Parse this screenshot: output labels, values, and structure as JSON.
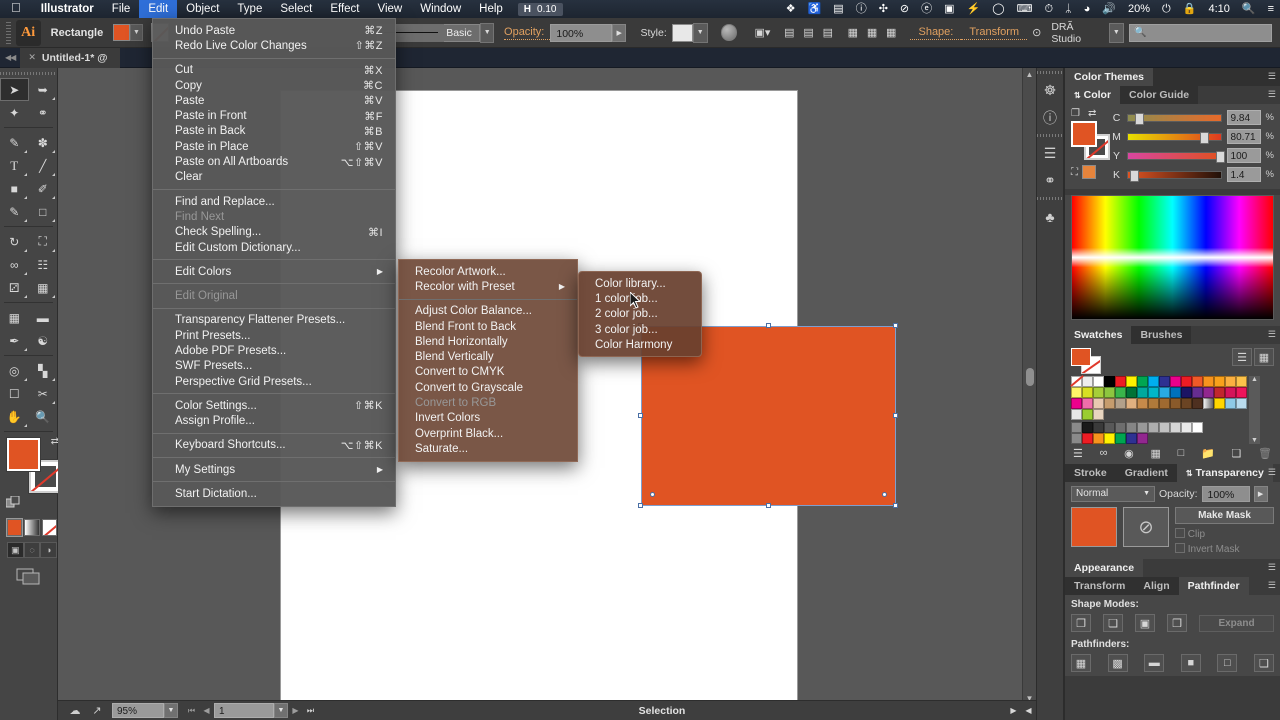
{
  "macbar": {
    "apple_icon": "apple-icon",
    "items": [
      {
        "label": "Illustrator",
        "bold": true,
        "active": false
      },
      {
        "label": "File",
        "bold": false,
        "active": false
      },
      {
        "label": "Edit",
        "bold": false,
        "active": true
      },
      {
        "label": "Object",
        "bold": false,
        "active": false
      },
      {
        "label": "Type",
        "bold": false,
        "active": false
      },
      {
        "label": "Select",
        "bold": false,
        "active": false
      },
      {
        "label": "Effect",
        "bold": false,
        "active": false
      },
      {
        "label": "View",
        "bold": false,
        "active": false
      },
      {
        "label": "Window",
        "bold": false,
        "active": false
      },
      {
        "label": "Help",
        "bold": false,
        "active": false
      }
    ],
    "badge": {
      "icon": "H",
      "value": "0.10"
    },
    "tray": [
      {
        "name": "dropbox-icon",
        "glyph": "❖"
      },
      {
        "name": "bell-icon",
        "glyph": "🔔"
      },
      {
        "name": "calendar-icon",
        "glyph": "📅"
      },
      {
        "name": "info-circle-icon",
        "glyph": "ⓘ"
      },
      {
        "name": "crosshair-icon",
        "glyph": "✣"
      },
      {
        "name": "do-not-disturb-icon",
        "glyph": "⊘"
      },
      {
        "name": "evernote-icon",
        "glyph": "ⓔ"
      },
      {
        "name": "airplay-icon",
        "glyph": "⬜"
      },
      {
        "name": "flash-icon",
        "glyph": "⚡"
      },
      {
        "name": "messages-icon",
        "glyph": "💬"
      },
      {
        "name": "keyboard-icon",
        "glyph": "⌸"
      },
      {
        "name": "timemachine-icon",
        "glyph": "⏲"
      },
      {
        "name": "bluetooth-icon",
        "glyph": "ᛦ"
      },
      {
        "name": "wifi-icon",
        "glyph": "📶"
      },
      {
        "name": "volume-icon",
        "glyph": "🔊"
      }
    ],
    "battery": "20%",
    "battery_icon": "battery-charging-icon",
    "lock_icon": "lock-icon",
    "clock": "4:10",
    "search_icon": "search-icon",
    "list_icon": "notification-center-icon"
  },
  "controlbar": {
    "app_logo": "Ai",
    "shape_label": "Rectangle",
    "fill_color": "#e05423",
    "stroke_label": "stroke-swatch",
    "brush_label": "Basic",
    "opacity_label": "Opacity:",
    "opacity_value": "100%",
    "style_label": "Style:",
    "shape_link": "Shape:",
    "transform_link": "Transform",
    "align_icons": [
      "align-left-icon",
      "align-center-icon",
      "align-right-icon",
      "distribute-left-icon",
      "distribute-center-icon",
      "distribute-right-icon"
    ],
    "isolate_icon": "isolate-selected-icon",
    "workspace": "DRÃ Studio",
    "search_placeholder": ""
  },
  "tabbar": {
    "doc_title": "Untitled-1* @",
    "close_icon": "close-icon"
  },
  "toolbar": {
    "tools": [
      [
        "selection-tool",
        "direct-selection-tool"
      ],
      [
        "magic-wand-tool",
        "lasso-tool"
      ],
      [
        "pen-tool",
        "curvature-tool"
      ],
      [
        "type-tool",
        "line-segment-tool"
      ],
      [
        "rectangle-tool",
        "paintbrush-tool"
      ],
      [
        "pencil-tool",
        "eraser-tool"
      ],
      [
        "rotate-tool",
        "scale-tool"
      ],
      [
        "width-tool",
        "free-transform-tool"
      ],
      [
        "shape-builder-tool",
        "perspective-grid-tool"
      ],
      [
        "mesh-tool",
        "gradient-tool"
      ],
      [
        "eyedropper-tool",
        "blend-tool"
      ],
      [
        "symbol-sprayer-tool",
        "column-graph-tool"
      ],
      [
        "artboard-tool",
        "slice-tool"
      ],
      [
        "hand-tool",
        "zoom-tool"
      ]
    ],
    "fill_color": "#e05423",
    "stroke_color": "#ffffff",
    "fill_stroke_name": "fill-stroke-indicator",
    "color_mode_icons": [
      "color-mode-icon",
      "gradient-mode-icon",
      "none-mode-icon"
    ],
    "draw_mode_icons": [
      "draw-normal-icon",
      "draw-behind-icon",
      "draw-inside-icon"
    ],
    "screen_mode_icon": "change-screen-mode-icon"
  },
  "canvas": {
    "artboard_name": "artboard",
    "rect_color": "#e05423",
    "selection_name": "selected-rectangle"
  },
  "statusbar": {
    "icons": [
      "cloud-sync-icon",
      "share-icon"
    ],
    "zoom": "95%",
    "page": "1",
    "status_text": "Selection"
  },
  "dock": {
    "icons": [
      "ship-wheel-icon",
      "info-icon",
      "layers-icon",
      "creative-cloud-icon",
      "symbols-icon"
    ]
  },
  "panels": {
    "color_themes": {
      "title": "Color Themes",
      "menu_icon": "panel-menu-icon"
    },
    "color": {
      "tabs": [
        "Color",
        "Color Guide"
      ],
      "active_tab": "Color",
      "fill_color": "#e05423",
      "channels": [
        {
          "label": "C",
          "value": "9.84",
          "unit": "%",
          "pos": 9.84,
          "from": "#8d8d50",
          "to": "#e86a2a"
        },
        {
          "label": "M",
          "value": "80.71",
          "unit": "%",
          "pos": 80.71,
          "from": "#e8e000",
          "to": "#e03a20"
        },
        {
          "label": "Y",
          "value": "100",
          "unit": "%",
          "pos": 100,
          "from": "#d846a0",
          "to": "#e0511f"
        },
        {
          "label": "K",
          "value": "1.4",
          "unit": "%",
          "pos": 1.4,
          "from": "#e05423",
          "to": "#201008"
        }
      ]
    },
    "swatches": {
      "tabs": [
        "Swatches",
        "Brushes"
      ],
      "active_tab": "Swatches",
      "list_icon": "list-view-icon",
      "grid_icon": "grid-view-icon",
      "rows": [
        [
          "none",
          "registration",
          "#ffffff",
          "#000000",
          "#ed1c24",
          "#fff200",
          "#00a651",
          "#00aeef",
          "#2e3192",
          "#ec008c",
          "#ed1c24",
          "#f05a28",
          "#f7941e",
          "#f9a11b",
          "#fbb040"
        ],
        [
          "#fff568",
          "#d7df23",
          "#8dc63f",
          "#39b54a",
          "#007236",
          "#00a99d",
          "#00b6c9",
          "#29abe2",
          "#0071bc",
          "#1b1464",
          "#662d91",
          "#92278f",
          "#c1272d",
          "#d4145a",
          "#ed145b"
        ],
        [
          "#ec008c",
          "#f06eaa",
          "#c69c6d",
          "#b3a08a",
          "#b88a6a",
          "#e0b080",
          "#c68a4a",
          "#a06a30",
          "#8a5a2a",
          "#6b4423",
          "#4e3020",
          "#3a2314",
          "#f5f5f5",
          "#ffd700",
          "#8ecae6"
        ],
        [
          "pattern-swatch-1",
          "pattern-swatch-2",
          "pattern-swatch-3"
        ],
        [
          "folder",
          "#1a1a1a",
          "#3a3a3a",
          "#595959",
          "#6e6e6e",
          "#858585",
          "#999999",
          "#adadad",
          "#c2c2c2",
          "#d6d6d6",
          "#eaeaea",
          "#ffffff"
        ],
        [
          "folder",
          "#ed1c24",
          "#f7941e",
          "#fff200",
          "#00a651",
          "#2e3192",
          "#92278f"
        ]
      ],
      "footer_icons": [
        "swatch-libraries-icon",
        "color-links-icon",
        "show-kinds-icon",
        "swatch-options-icon",
        "new-color-group-icon",
        "new-swatch-icon",
        "delete-swatch-icon"
      ]
    },
    "transparency": {
      "tabs": [
        "Stroke",
        "Gradient",
        "Transparency"
      ],
      "active_tab": "Transparency",
      "blend_mode": "Normal",
      "opacity_label": "Opacity:",
      "opacity_value": "100%",
      "thumb_color": "#e05423",
      "mask_icon": "no-mask-icon",
      "make_mask": "Make Mask",
      "clip": "Clip",
      "invert_mask": "Invert Mask"
    },
    "appearance": {
      "title": "Appearance"
    },
    "pathfinder": {
      "tabs": [
        "Transform",
        "Align",
        "Pathfinder"
      ],
      "active_tab": "Pathfinder",
      "shape_modes_label": "Shape Modes:",
      "expand_label": "Expand",
      "pathfinders_label": "Pathfinders:",
      "shape_mode_icons": [
        "unite-icon",
        "minus-front-icon",
        "intersect-icon",
        "exclude-icon"
      ],
      "pathfinder_icons": [
        "divide-icon",
        "trim-icon",
        "merge-icon",
        "crop-icon",
        "outline-icon",
        "minus-back-icon"
      ]
    }
  },
  "menus": {
    "edit": {
      "name": "edit-menu",
      "groups": [
        [
          {
            "label": "Undo Paste",
            "key": "⌘Z"
          },
          {
            "label": "Redo Live Color Changes",
            "key": "⇧⌘Z"
          }
        ],
        [
          {
            "label": "Cut",
            "key": "⌘X"
          },
          {
            "label": "Copy",
            "key": "⌘C"
          },
          {
            "label": "Paste",
            "key": "⌘V"
          },
          {
            "label": "Paste in Front",
            "key": "⌘F"
          },
          {
            "label": "Paste in Back",
            "key": "⌘B"
          },
          {
            "label": "Paste in Place",
            "key": "⇧⌘V"
          },
          {
            "label": "Paste on All Artboards",
            "key": "⌥⇧⌘V"
          },
          {
            "label": "Clear",
            "key": ""
          }
        ],
        [
          {
            "label": "Find and Replace...",
            "key": ""
          },
          {
            "label": "Find Next",
            "key": "",
            "disabled": true
          },
          {
            "label": "Check Spelling...",
            "key": "⌘I"
          },
          {
            "label": "Edit Custom Dictionary...",
            "key": ""
          }
        ],
        [
          {
            "label": "Edit Colors",
            "key": "",
            "submenu": true,
            "highlight": true
          }
        ],
        [
          {
            "label": "Edit Original",
            "key": "",
            "disabled": true
          }
        ],
        [
          {
            "label": "Transparency Flattener Presets...",
            "key": ""
          },
          {
            "label": "Print Presets...",
            "key": ""
          },
          {
            "label": "Adobe PDF Presets...",
            "key": ""
          },
          {
            "label": "SWF Presets...",
            "key": ""
          },
          {
            "label": "Perspective Grid Presets...",
            "key": ""
          }
        ],
        [
          {
            "label": "Color Settings...",
            "key": "⇧⌘K"
          },
          {
            "label": "Assign Profile...",
            "key": ""
          }
        ],
        [
          {
            "label": "Keyboard Shortcuts...",
            "key": "⌥⇧⌘K"
          }
        ],
        [
          {
            "label": "My Settings",
            "key": "",
            "submenu": true
          }
        ],
        [
          {
            "label": "Start Dictation...",
            "key": ""
          }
        ]
      ]
    },
    "edit_colors": {
      "name": "edit-colors-submenu",
      "groups": [
        [
          {
            "label": "Recolor Artwork...",
            "key": ""
          },
          {
            "label": "Recolor with Preset",
            "key": "",
            "submenu": true,
            "highlight": true
          }
        ],
        [
          {
            "label": "Adjust Color Balance...",
            "key": ""
          },
          {
            "label": "Blend Front to Back",
            "key": ""
          },
          {
            "label": "Blend Horizontally",
            "key": ""
          },
          {
            "label": "Blend Vertically",
            "key": ""
          },
          {
            "label": "Convert to CMYK",
            "key": ""
          },
          {
            "label": "Convert to Grayscale",
            "key": ""
          },
          {
            "label": "Convert to RGB",
            "key": "",
            "disabled": true
          },
          {
            "label": "Invert Colors",
            "key": ""
          },
          {
            "label": "Overprint Black...",
            "key": ""
          },
          {
            "label": "Saturate...",
            "key": ""
          }
        ]
      ]
    },
    "recolor_preset": {
      "name": "recolor-with-preset-submenu",
      "groups": [
        [
          {
            "label": "Color library...",
            "key": ""
          },
          {
            "label": "1 color job...",
            "key": ""
          },
          {
            "label": "2 color job...",
            "key": ""
          },
          {
            "label": "3 color job...",
            "key": ""
          },
          {
            "label": "Color Harmony",
            "key": ""
          }
        ]
      ]
    }
  }
}
